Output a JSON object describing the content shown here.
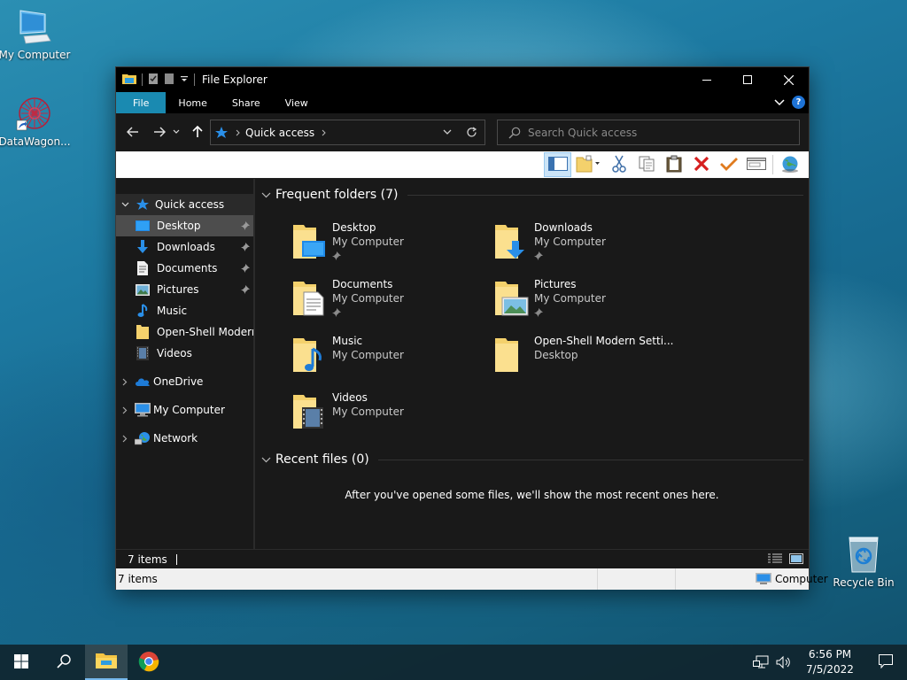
{
  "desktop": {
    "icons": [
      {
        "label": "My Computer",
        "icon": "computer-icon"
      },
      {
        "label": "DataWagon...",
        "icon": "datawagon-shortcut-icon"
      },
      {
        "label": "Recycle Bin",
        "icon": "recycle-bin-icon"
      }
    ]
  },
  "window": {
    "title": "File Explorer",
    "ribbon_tabs": [
      "File",
      "Home",
      "Share",
      "View"
    ],
    "address": {
      "breadcrumb": "Quick access"
    },
    "search": {
      "placeholder": "Search Quick access"
    },
    "toolbar_icons": [
      "details-pane-icon",
      "new-folder-icon",
      "cut-icon",
      "copy-icon",
      "paste-icon",
      "delete-icon",
      "select-icon",
      "properties-icon",
      "internet-icon"
    ],
    "colors": {
      "accent": "#1a8ab1",
      "background": "#191919",
      "selection": "#4d4d4d"
    }
  },
  "nav": {
    "quick_access": "Quick access",
    "pinned": [
      {
        "label": "Desktop",
        "pinned": true
      },
      {
        "label": "Downloads",
        "pinned": true
      },
      {
        "label": "Documents",
        "pinned": true
      },
      {
        "label": "Pictures",
        "pinned": true
      },
      {
        "label": "Music",
        "pinned": false
      },
      {
        "label": "Open-Shell Modern",
        "pinned": false
      },
      {
        "label": "Videos",
        "pinned": false
      }
    ],
    "roots": [
      "OneDrive",
      "My Computer",
      "Network"
    ]
  },
  "content": {
    "frequent_header": "Frequent folders (7)",
    "folders": [
      {
        "name": "Desktop",
        "location": "My Computer",
        "pinned": true
      },
      {
        "name": "Downloads",
        "location": "My Computer",
        "pinned": true
      },
      {
        "name": "Documents",
        "location": "My Computer",
        "pinned": true
      },
      {
        "name": "Pictures",
        "location": "My Computer",
        "pinned": true
      },
      {
        "name": "Music",
        "location": "My Computer",
        "pinned": false
      },
      {
        "name": "Open-Shell Modern Setti...",
        "location": "Desktop",
        "pinned": false
      },
      {
        "name": "Videos",
        "location": "My Computer",
        "pinned": false
      }
    ],
    "recent_header": "Recent files (0)",
    "empty_message": "After you've opened some files, we'll show the most recent ones here."
  },
  "status": {
    "items": "7 items",
    "classic_items": "7 items",
    "zone": "Computer"
  },
  "taskbar": {
    "time": "6:56 PM",
    "date": "7/5/2022"
  }
}
